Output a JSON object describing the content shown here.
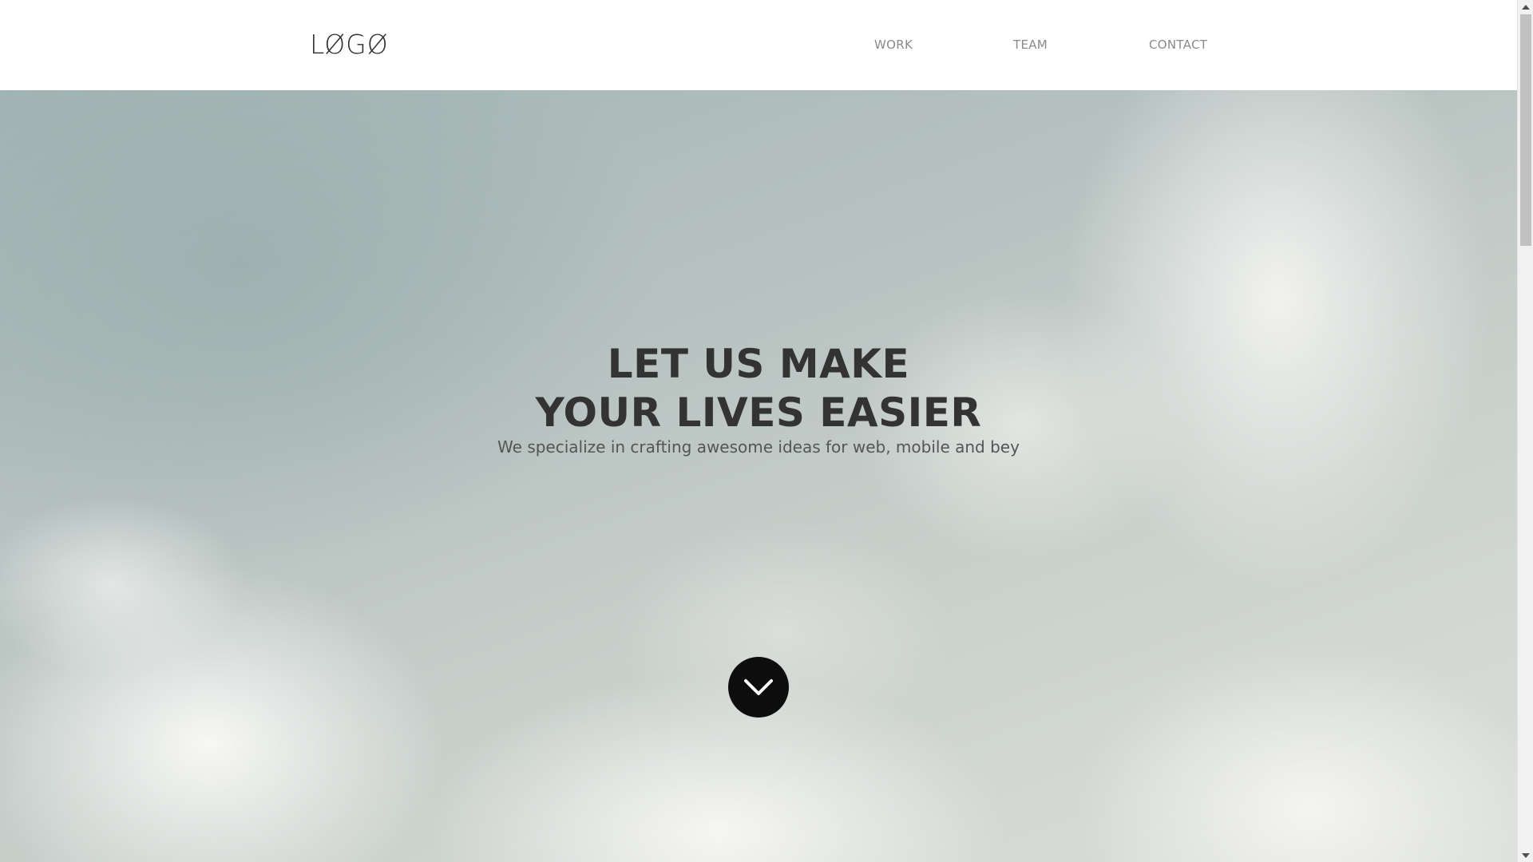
{
  "header": {
    "logo": "LØGØ",
    "nav": [
      {
        "label": "WORK"
      },
      {
        "label": "TEAM"
      },
      {
        "label": "CONTACT"
      }
    ]
  },
  "hero": {
    "title_line1": "LET US MAKE",
    "title_line2": "YOUR LIVES EASIER",
    "subtitle": "We specialize in crafting awesome ideas for web, mobile and bey",
    "scroll_button_icon": "chevron-down-icon"
  },
  "colors": {
    "title": "#333333",
    "subtitle": "#555555",
    "nav": "#8a8a8a",
    "scroll_button": "#0d0d0d"
  }
}
